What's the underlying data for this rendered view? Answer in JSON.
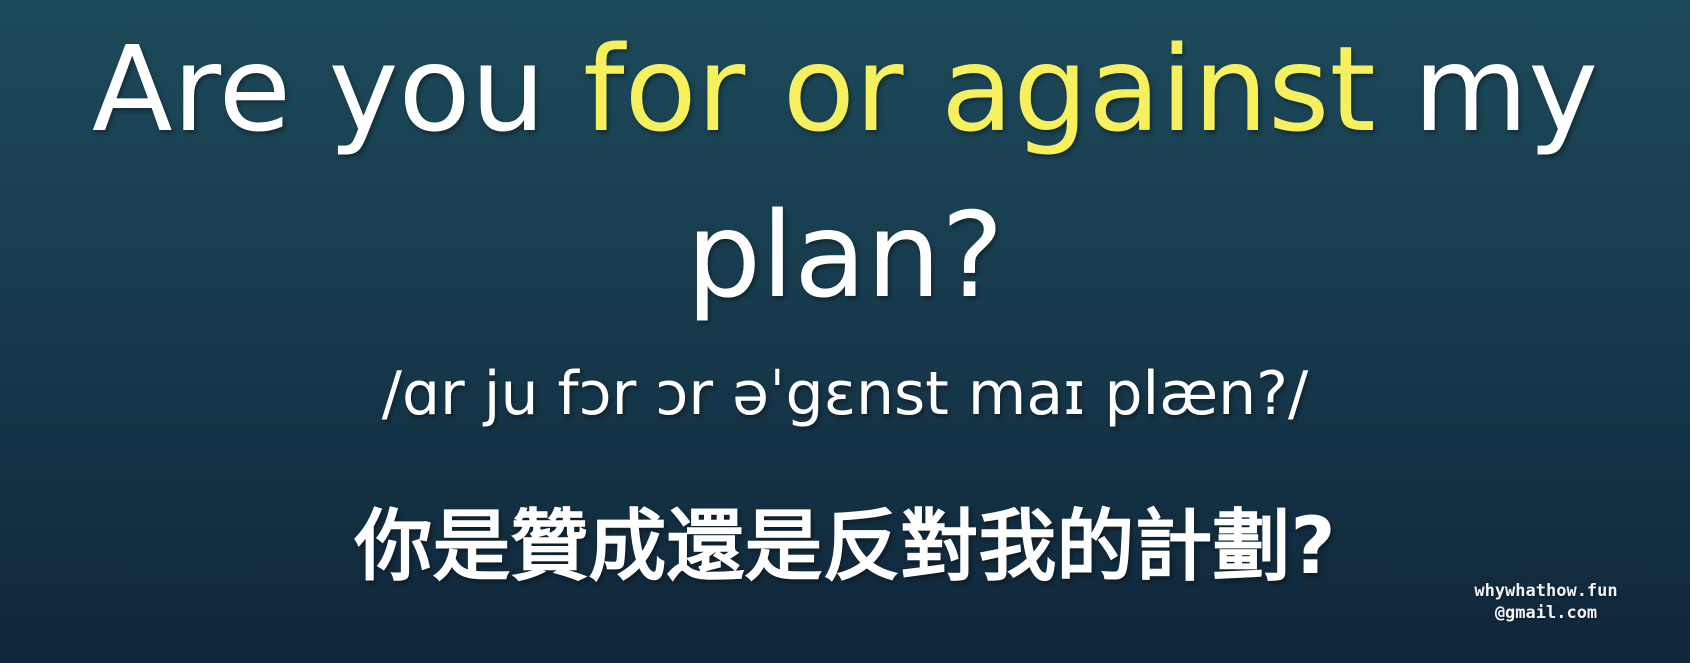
{
  "sentence": {
    "line1": {
      "pre": "Are you ",
      "highlight": "for or against",
      "post": " my"
    },
    "line2": "plan?",
    "highlight_color": "#f6ef5e"
  },
  "ipa": "/ɑr ju fɔr ɔr əˈgɛnst maɪ plæn?/",
  "translation": "你是贊成還是反對我的計劃?",
  "watermark": {
    "line1": "whywhathow.fun",
    "line2": "@gmail.com"
  }
}
